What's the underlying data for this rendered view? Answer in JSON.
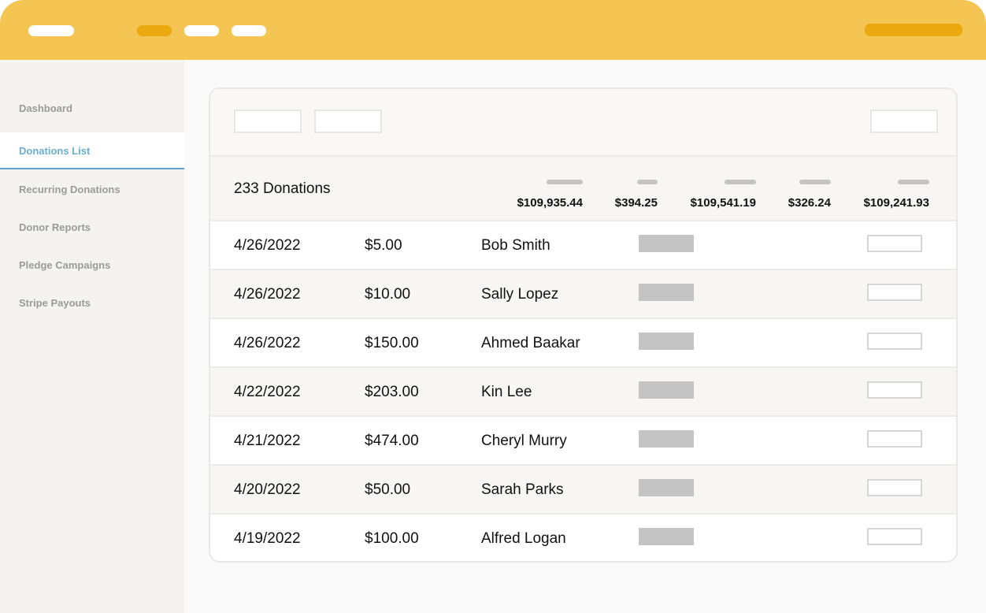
{
  "colors": {
    "header": "#f4c552",
    "accent_pill": "#e9a90f",
    "active_nav": "#6aaed3"
  },
  "sidebar": {
    "items": [
      {
        "label": "Dashboard",
        "active": false
      },
      {
        "label": "Donations List",
        "active": true
      },
      {
        "label": "Recurring Donations",
        "active": false
      },
      {
        "label": "Donor Reports",
        "active": false
      },
      {
        "label": "Pledge Campaigns",
        "active": false
      },
      {
        "label": "Stripe Payouts",
        "active": false
      }
    ]
  },
  "summary": {
    "count": "233 Donations",
    "totals": [
      "$109,935.44",
      "$394.25",
      "$109,541.19",
      "$326.24",
      "$109,241.93"
    ]
  },
  "rows": [
    {
      "date": "4/26/2022",
      "amount": "$5.00",
      "name": "Bob Smith"
    },
    {
      "date": "4/26/2022",
      "amount": "$10.00",
      "name": "Sally Lopez"
    },
    {
      "date": "4/26/2022",
      "amount": "$150.00",
      "name": "Ahmed Baakar"
    },
    {
      "date": "4/22/2022",
      "amount": "$203.00",
      "name": "Kin Lee"
    },
    {
      "date": "4/21/2022",
      "amount": "$474.00",
      "name": "Cheryl Murry"
    },
    {
      "date": "4/20/2022",
      "amount": "$50.00",
      "name": "Sarah Parks"
    },
    {
      "date": "4/19/2022",
      "amount": "$100.00",
      "name": "Alfred Logan"
    }
  ]
}
